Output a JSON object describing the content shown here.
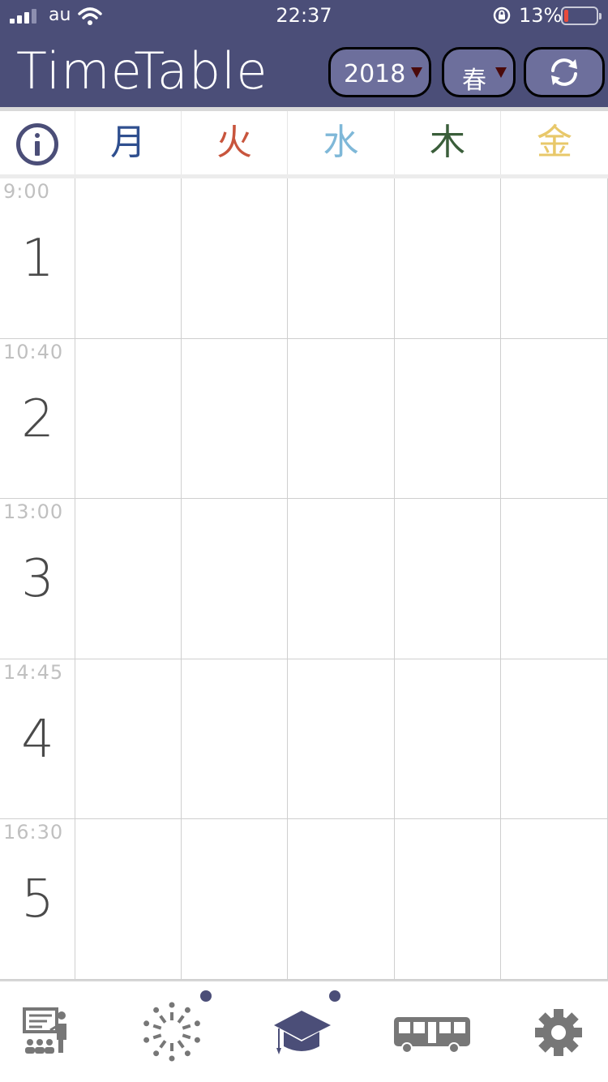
{
  "status_bar": {
    "carrier": "au",
    "time": "22:37",
    "battery_percent": "13%",
    "battery_level": 0.13,
    "battery_color": "#e84b3c"
  },
  "header": {
    "title": "TimeTable",
    "year": "2018",
    "season": "春",
    "refresh_icon": "refresh-icon",
    "background": "#4b4e78"
  },
  "days": [
    {
      "label": "月",
      "color": "#2f4f8f"
    },
    {
      "label": "火",
      "color": "#c8553d"
    },
    {
      "label": "水",
      "color": "#7fb8d8"
    },
    {
      "label": "木",
      "color": "#3a5e3a"
    },
    {
      "label": "金",
      "color": "#e8c86a"
    }
  ],
  "info_icon": "info-icon",
  "periods": [
    {
      "number": "1",
      "time": "9:00"
    },
    {
      "number": "2",
      "time": "10:40"
    },
    {
      "number": "3",
      "time": "13:00"
    },
    {
      "number": "4",
      "time": "14:45"
    },
    {
      "number": "5",
      "time": "16:30"
    }
  ],
  "tab_bar": {
    "tabs": [
      {
        "icon": "classroom-icon",
        "badge": false
      },
      {
        "icon": "community-icon",
        "badge": true
      },
      {
        "icon": "graduation-cap-icon",
        "badge": true,
        "active": true
      },
      {
        "icon": "bus-icon",
        "badge": false
      },
      {
        "icon": "gear-icon",
        "badge": false
      }
    ],
    "active_color": "#4b4e78",
    "inactive_color": "#777777"
  }
}
